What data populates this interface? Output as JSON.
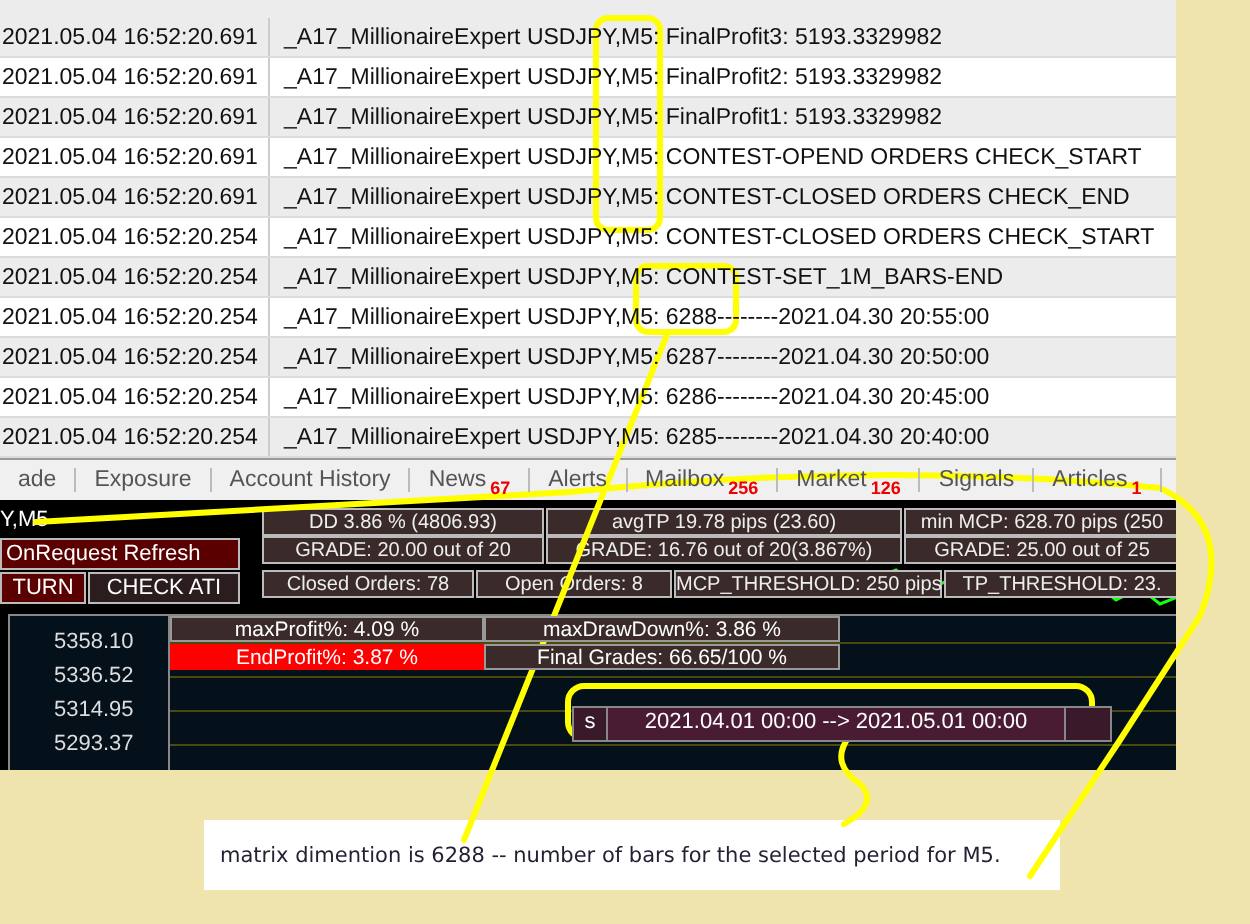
{
  "log": {
    "rows": [
      {
        "time": "2021.05.04 16:52:20.691",
        "message": "_A17_MillionaireExpert USDJPY,M5: FinalProfit3: 5193.3329982"
      },
      {
        "time": "2021.05.04 16:52:20.691",
        "message": "_A17_MillionaireExpert USDJPY,M5: FinalProfit2: 5193.3329982"
      },
      {
        "time": "2021.05.04 16:52:20.691",
        "message": "_A17_MillionaireExpert USDJPY,M5: FinalProfit1: 5193.3329982"
      },
      {
        "time": "2021.05.04 16:52:20.691",
        "message": "_A17_MillionaireExpert USDJPY,M5: CONTEST-OPEND ORDERS CHECK_START"
      },
      {
        "time": "2021.05.04 16:52:20.691",
        "message": "_A17_MillionaireExpert USDJPY,M5: CONTEST-CLOSED ORDERS CHECK_END"
      },
      {
        "time": "2021.05.04 16:52:20.254",
        "message": "_A17_MillionaireExpert USDJPY,M5: CONTEST-CLOSED ORDERS CHECK_START"
      },
      {
        "time": "2021.05.04 16:52:20.254",
        "message": "_A17_MillionaireExpert USDJPY,M5: CONTEST-SET_1M_BARS-END"
      },
      {
        "time": "2021.05.04 16:52:20.254",
        "message": "_A17_MillionaireExpert USDJPY,M5: 6288--------2021.04.30 20:55:00"
      },
      {
        "time": "2021.05.04 16:52:20.254",
        "message": "_A17_MillionaireExpert USDJPY,M5: 6287--------2021.04.30 20:50:00"
      },
      {
        "time": "2021.05.04 16:52:20.254",
        "message": "_A17_MillionaireExpert USDJPY,M5: 6286--------2021.04.30 20:45:00"
      },
      {
        "time": "2021.05.04 16:52:20.254",
        "message": "_A17_MillionaireExpert USDJPY,M5: 6285--------2021.04.30 20:40:00"
      }
    ]
  },
  "tabs": [
    {
      "label": "ade"
    },
    {
      "label": "Exposure"
    },
    {
      "label": "Account History"
    },
    {
      "label": "News",
      "badge": "67"
    },
    {
      "label": "Alerts"
    },
    {
      "label": "Mailbox",
      "badge": "256"
    },
    {
      "label": "Market",
      "badge": "126"
    },
    {
      "label": "Signals"
    },
    {
      "label": "Articles",
      "badge": "1"
    }
  ],
  "expert_panel": {
    "symbol": "Y,M5",
    "buttons": [
      {
        "label": "OnRequest Refresh",
        "kind": "wide"
      },
      {
        "label": "TURN",
        "kind": "small"
      },
      {
        "label": "CHECK ATI",
        "kind": "dark"
      }
    ],
    "stat_rows": [
      [
        "DD 3.86 % (4806.93)",
        "avgTP 19.78 pips (23.60)",
        "min MCP: 628.70 pips (250"
      ],
      [
        "GRADE: 20.00 out of 20",
        "GRADE:  16.76 out of 20(3.867%)",
        "GRADE:  25.00 out of 25"
      ],
      [
        "Closed Orders: 78",
        "Open Orders: 8",
        "MCP_THRESHOLD: 250 pips",
        "TP_THRESHOLD: 23."
      ]
    ]
  },
  "chart": {
    "price_labels": [
      "5358.10",
      "5336.52",
      "5314.95",
      "5293.37"
    ],
    "results": [
      {
        "label": "maxProfit%: 4.09 %",
        "kind": "stat"
      },
      {
        "label": "maxDrawDown%: 3.86 %",
        "kind": "stat"
      },
      {
        "label": "EndProfit%: 3.87 %",
        "kind": "alert"
      },
      {
        "label": "Final Grades: 66.65/100 %",
        "kind": "stat"
      }
    ],
    "date_range": {
      "prefix": "s",
      "label": "2021.04.01 00:00 --> 2021.05.01 00:00"
    }
  },
  "note": "matrix dimention is 6288 -- number of bars for the selected period for M5."
}
